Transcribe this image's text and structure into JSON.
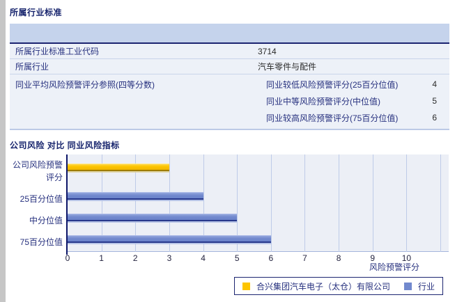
{
  "section1": {
    "title": "所属行业标准",
    "rows": [
      {
        "label": "所属行业标准工业代码",
        "value": "3714"
      },
      {
        "label": "所属行业",
        "value": "汽车零件与配件"
      }
    ],
    "group_row": {
      "label": "同业平均风险预警评分参照(四等分数)",
      "items": [
        {
          "label": "同业较低风险预警评分(25百分位值)",
          "value": "4"
        },
        {
          "label": "同业中等风险预警评分(中位值)",
          "value": "5"
        },
        {
          "label": "同业较高风险预警评分(75百分位值)",
          "value": "6"
        }
      ]
    }
  },
  "section2": {
    "title": "公司风险 对比 同业风险指标"
  },
  "chart_data": {
    "type": "bar",
    "orientation": "horizontal",
    "title": "",
    "categories": [
      "公司风险预警评分",
      "25百分位值",
      "中分位值",
      "75百分位值"
    ],
    "series": [
      {
        "name": "合兴集团汽车电子（太仓）有限公司",
        "color": "#FDC500",
        "values": [
          3,
          null,
          null,
          null
        ]
      },
      {
        "name": "行业",
        "color": "#7289CE",
        "values": [
          null,
          4,
          5,
          6
        ]
      }
    ],
    "xlabel": "风险预警评分",
    "xticks": [
      0,
      1,
      2,
      3,
      4,
      5,
      6,
      7,
      8,
      9,
      10
    ],
    "xlim": [
      0,
      11.25
    ],
    "grid": "vertical",
    "plot_bg": "#ECEFF6",
    "legend_position": "bottom"
  },
  "colors": {
    "navy_text": "#26307e",
    "table_header_bg": "#C5D3EC",
    "table_row_bg": "#EDF1F8",
    "header_border": "#1B2470",
    "company_bar": "#FDC500",
    "industry_bar": "#7289CE"
  }
}
